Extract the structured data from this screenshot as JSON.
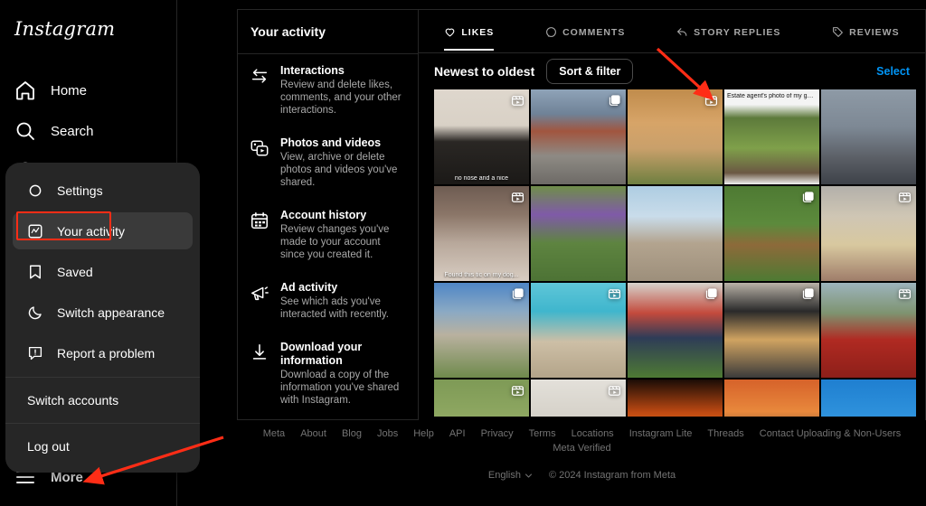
{
  "brand": {
    "logo_text": "Instagram",
    "accent_blue": "#0095f6",
    "annotation_red": "#ff2d16"
  },
  "sidebar": {
    "items": [
      {
        "label": "Home",
        "icon": "home-icon"
      },
      {
        "label": "Search",
        "icon": "search-icon"
      }
    ],
    "more": {
      "label": "More",
      "icon": "hamburger-icon"
    }
  },
  "more_menu": {
    "items": [
      {
        "label": "Settings",
        "icon": "gear-icon",
        "active": false
      },
      {
        "label": "Your activity",
        "icon": "activity-chart-icon",
        "active": true
      },
      {
        "label": "Saved",
        "icon": "bookmark-icon",
        "active": false
      },
      {
        "label": "Switch appearance",
        "icon": "moon-icon",
        "active": false
      },
      {
        "label": "Report a problem",
        "icon": "warning-icon",
        "active": false
      }
    ],
    "switch_accounts": "Switch accounts",
    "log_out": "Log out"
  },
  "activity_panel": {
    "title": "Your activity",
    "items": [
      {
        "title": "Interactions",
        "desc": "Review and delete likes, comments, and your other interactions.",
        "icon": "arrows-exchange-icon"
      },
      {
        "title": "Photos and videos",
        "desc": "View, archive or delete photos and videos you've shared.",
        "icon": "photo-video-icon"
      },
      {
        "title": "Account history",
        "desc": "Review changes you've made to your account since you created it.",
        "icon": "calendar-icon"
      },
      {
        "title": "Ad activity",
        "desc": "See which ads you've interacted with recently.",
        "icon": "megaphone-icon"
      },
      {
        "title": "Download your information",
        "desc": "Download a copy of the information you've shared with Instagram.",
        "icon": "download-icon"
      }
    ]
  },
  "main": {
    "tabs": [
      {
        "label": "LIKES",
        "icon": "heart-icon",
        "active": true
      },
      {
        "label": "COMMENTS",
        "icon": "comment-icon",
        "active": false
      },
      {
        "label": "STORY REPLIES",
        "icon": "reply-arrow-icon",
        "active": false
      },
      {
        "label": "REVIEWS",
        "icon": "tag-icon",
        "active": false
      }
    ],
    "sort_label": "Newest to oldest",
    "sort_filter_button": "Sort & filter",
    "select_link": "Select",
    "grid": [
      {
        "badge": "reel-icon",
        "caption": "no nose and a nice",
        "caption_dark": false,
        "art": "man-haircut"
      },
      {
        "badge": "carousel-icon",
        "caption": "",
        "caption_dark": false,
        "art": "dog-stadium"
      },
      {
        "badge": "reel-icon",
        "caption": "",
        "caption_dark": false,
        "art": "two-foxes"
      },
      {
        "badge": "",
        "caption": "Estate agent's photo of my garden",
        "caption_dark": true,
        "art": "garden-listing"
      },
      {
        "badge": "",
        "caption": "",
        "caption_dark": false,
        "art": "cathedral-gate"
      },
      {
        "badge": "reel-icon",
        "caption": "Found this tic on my dog...",
        "caption_dark": false,
        "art": "tick-on-dog"
      },
      {
        "badge": "",
        "caption": "",
        "caption_dark": false,
        "art": "lupine-field"
      },
      {
        "badge": "",
        "caption": "",
        "caption_dark": false,
        "art": "jack-russell-beach"
      },
      {
        "badge": "carousel-icon",
        "caption": "",
        "caption_dark": false,
        "art": "dog-on-grass"
      },
      {
        "badge": "reel-icon",
        "caption": "",
        "caption_dark": false,
        "art": "yellow-lab-porch"
      },
      {
        "badge": "carousel-icon",
        "caption": "",
        "caption_dark": false,
        "art": "mountain-climber"
      },
      {
        "badge": "reel-icon",
        "caption": "",
        "caption_dark": false,
        "art": "dog-pool"
      },
      {
        "badge": "carousel-icon",
        "caption": "",
        "caption_dark": false,
        "art": "f1-drivers-dogs"
      },
      {
        "badge": "carousel-icon",
        "caption": "",
        "caption_dark": false,
        "art": "corgi-indoors"
      },
      {
        "badge": "reel-icon",
        "caption": "",
        "caption_dark": false,
        "art": "dog-sleeping-bag"
      },
      {
        "badge": "reel-icon",
        "caption": "",
        "caption_dark": false,
        "art": "cows-field"
      },
      {
        "badge": "reel-icon",
        "caption": "",
        "caption_dark": false,
        "art": "cat-stairs"
      },
      {
        "badge": "",
        "caption": "",
        "caption_dark": false,
        "art": "man-fire"
      },
      {
        "badge": "",
        "caption": "",
        "caption_dark": false,
        "art": "sunset-mountain"
      },
      {
        "badge": "",
        "caption": "",
        "caption_dark": false,
        "art": "crane-sky"
      }
    ]
  },
  "footer": {
    "links": [
      "Meta",
      "About",
      "Blog",
      "Jobs",
      "Help",
      "API",
      "Privacy",
      "Terms",
      "Locations",
      "Instagram Lite",
      "Threads",
      "Contact Uploading & Non-Users",
      "Meta Verified"
    ],
    "language": "English",
    "copyright": "© 2024 Instagram from Meta"
  }
}
